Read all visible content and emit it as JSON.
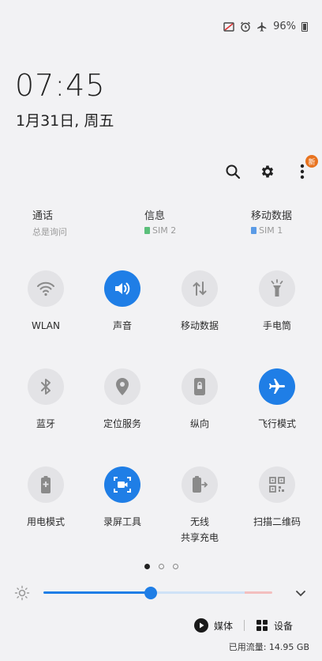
{
  "status_bar": {
    "battery": "96%"
  },
  "clock": {
    "time": "07:45",
    "date": "1月31日, 周五"
  },
  "header": {
    "new_badge": "新"
  },
  "sim_info": [
    {
      "title": "通话",
      "subtitle": "总是询问",
      "chip": ""
    },
    {
      "title": "信息",
      "subtitle": "SIM 2",
      "chip": "#5bbf7a"
    },
    {
      "title": "移动数据",
      "subtitle": "SIM 1",
      "chip": "#5b9be6"
    }
  ],
  "tiles": [
    {
      "label": "WLAN",
      "icon": "wifi-icon",
      "on": false
    },
    {
      "label": "声音",
      "icon": "sound-icon",
      "on": true
    },
    {
      "label": "移动数据",
      "icon": "mobile-data-icon",
      "on": false
    },
    {
      "label": "手电筒",
      "icon": "flashlight-icon",
      "on": false
    },
    {
      "label": "蓝牙",
      "icon": "bluetooth-icon",
      "on": false
    },
    {
      "label": "定位服务",
      "icon": "location-icon",
      "on": false
    },
    {
      "label": "纵向",
      "icon": "portrait-lock-icon",
      "on": false
    },
    {
      "label": "飞行模式",
      "icon": "airplane-icon",
      "on": true
    },
    {
      "label": "用电模式",
      "icon": "power-mode-icon",
      "on": false
    },
    {
      "label": "录屏工具",
      "icon": "screen-recorder-icon",
      "on": true
    },
    {
      "label": "无线\n共享充电",
      "icon": "wireless-powershare-icon",
      "on": false
    },
    {
      "label": "扫描二维码",
      "icon": "qr-scan-icon",
      "on": false
    }
  ],
  "page_indicator": {
    "total": 3,
    "current": 1
  },
  "brightness": {
    "level": 0.47
  },
  "bottom": {
    "media_label": "媒体",
    "devices_label": "设备",
    "data_usage": "已用流量: 14.95 GB"
  },
  "colors": {
    "accent": "#1f7ee6",
    "badge": "#e8731f",
    "background": "#f2f2f4"
  }
}
